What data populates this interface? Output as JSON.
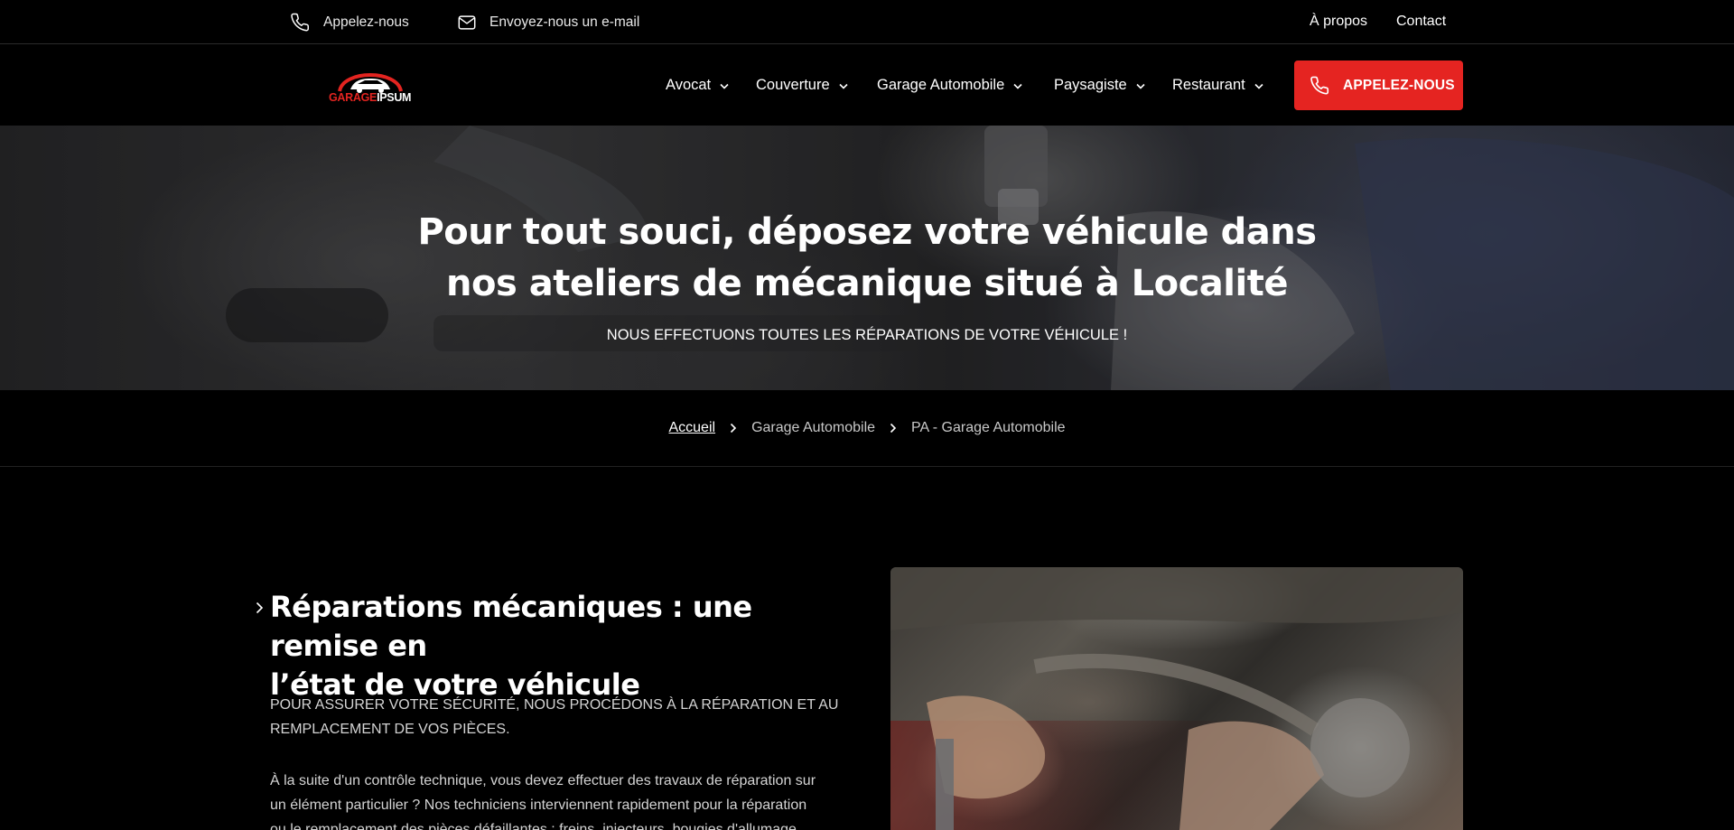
{
  "topbar": {
    "phone_label": "Appelez-nous",
    "email_label": "Envoyez-nous un e-mail",
    "about_label": "À propos",
    "contact_label": "Contact"
  },
  "logo": {
    "part1": "GARAGE",
    "part2": "IPSUM"
  },
  "nav": {
    "items": [
      {
        "label": "Avocat",
        "icon": "chevron-down-icon"
      },
      {
        "label": "Couverture",
        "icon": "chevron-down-icon"
      },
      {
        "label": "Garage Automobile",
        "icon": "chevron-down-icon"
      },
      {
        "label": "Paysagiste",
        "icon": "chevron-down-icon"
      },
      {
        "label": "Restaurant",
        "icon": "chevron-down-icon"
      }
    ],
    "cta_label": "APPELEZ-NOUS"
  },
  "hero": {
    "title_line1": "Pour tout souci, déposez votre véhicule dans",
    "title_line2": "nos ateliers de mécanique situé à Localité",
    "subtitle": "NOUS EFFECTUONS TOUTES LES RÉPARATIONS DE VOTRE VÉHICULE !"
  },
  "breadcrumb": {
    "items": [
      "Accueil",
      "Garage Automobile",
      "PA - Garage Automobile"
    ]
  },
  "section": {
    "title_line1": "Réparations mécaniques : une remise en",
    "title_line2": "l’état de votre véhicule",
    "lead_line1": "POUR ASSURER VOTRE SÉCURITÉ, NOUS PROCÉDONS À LA RÉPARATION ET AU",
    "lead_line2": "REMPLACEMENT DE VOS PIÈCES.",
    "body_line1": "À la suite d'un contrôle technique, vous devez effectuer des travaux de réparation sur",
    "body_line2": "un élément particulier ? Nos techniciens interviennent rapidement pour la réparation",
    "body_line3": "ou le remplacement des pièces défaillantes : freins, injecteurs, bougies d'allumage,"
  },
  "colors": {
    "accent": "#e52421",
    "background": "#000000",
    "text": "#ffffff"
  }
}
